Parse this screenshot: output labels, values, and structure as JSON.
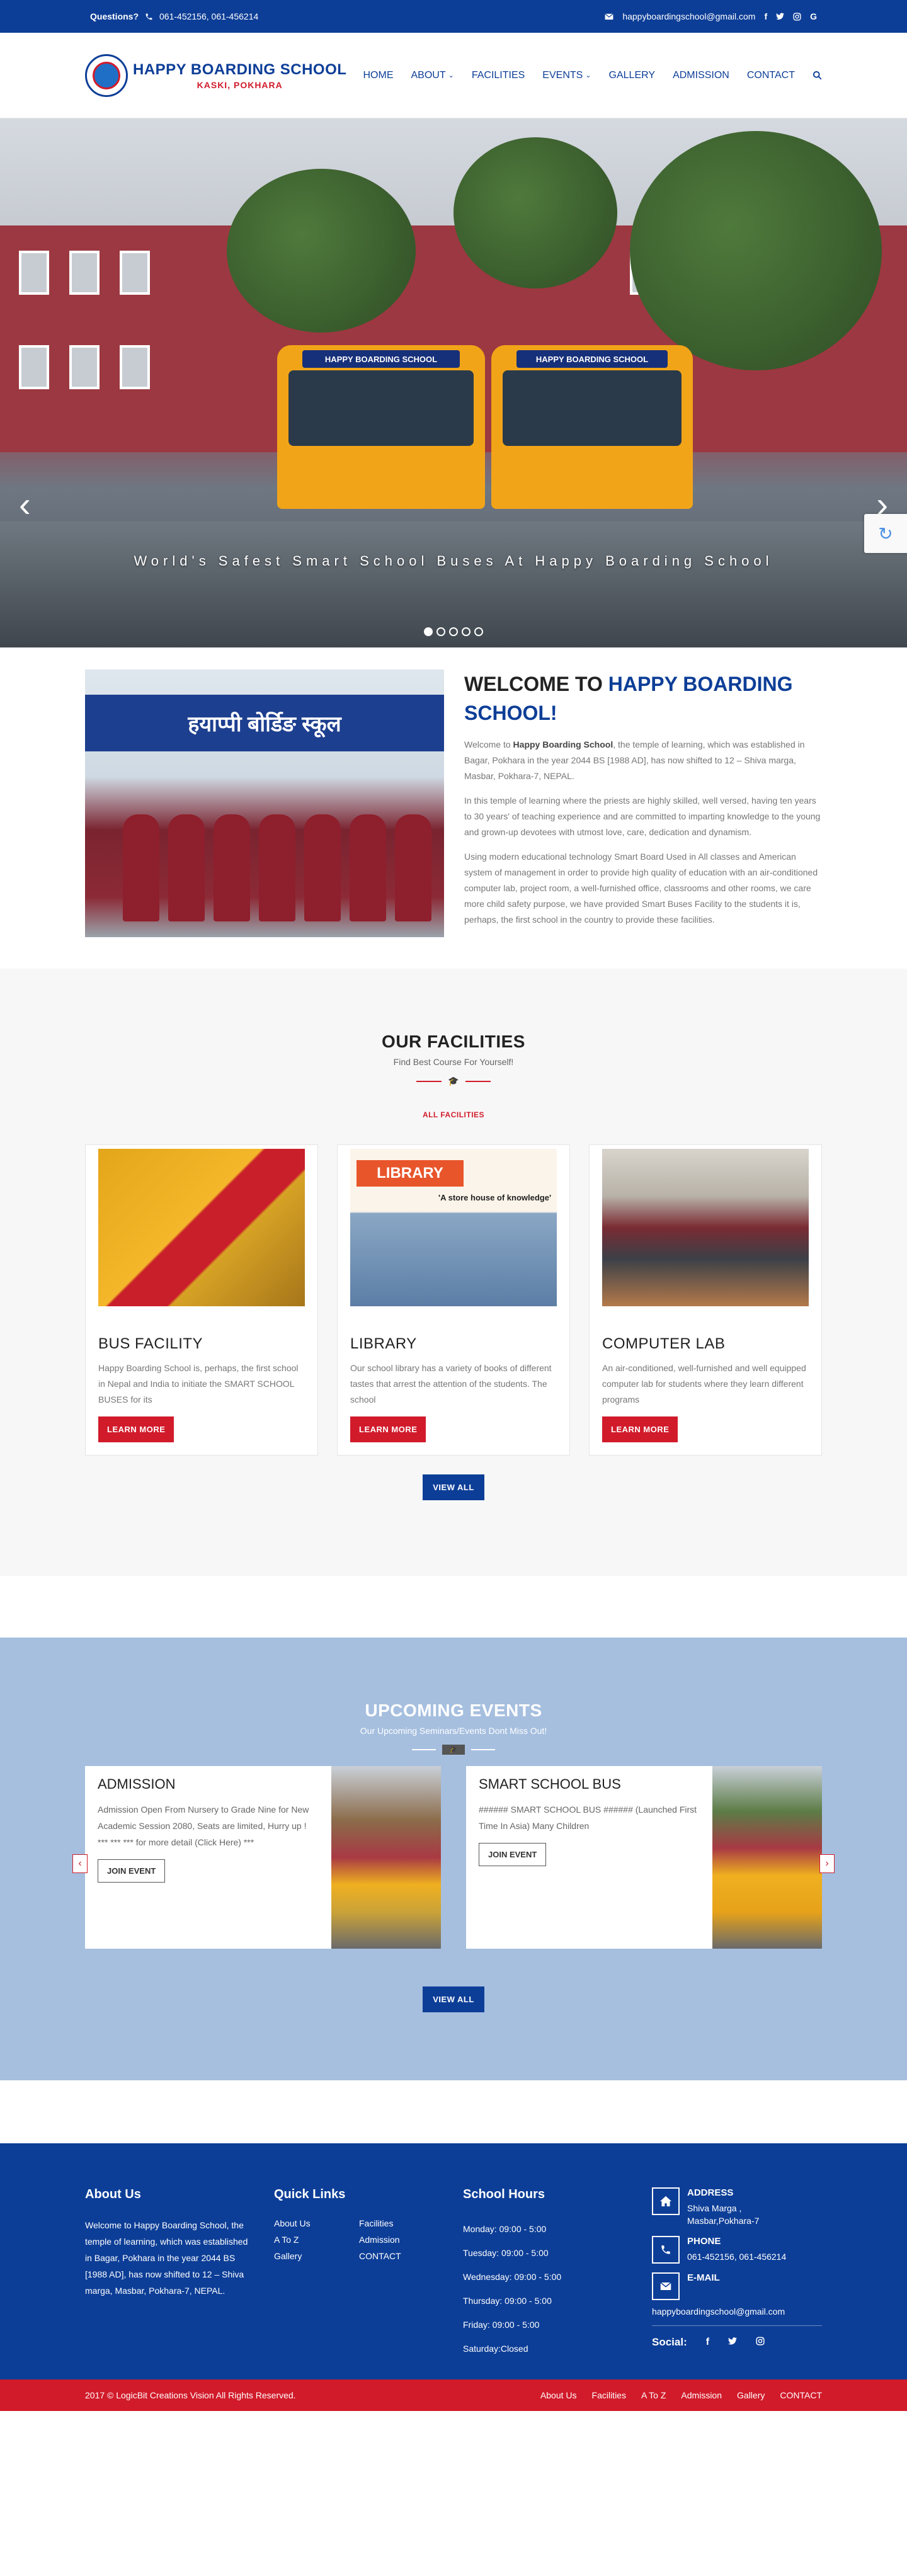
{
  "topbar": {
    "questions_label": "Questions?",
    "phone": "061-452156, 061-456214",
    "email": "happyboardingschool@gmail.com",
    "colors": {
      "background": "#0d3e97",
      "text": "#ffffff"
    }
  },
  "header": {
    "school_name": "HAPPY BOARDING SCHOOL",
    "school_location": "KASKI, POKHARA",
    "nav": [
      {
        "label": "HOME"
      },
      {
        "label": "ABOUT"
      },
      {
        "label": "FACILITIES"
      },
      {
        "label": "EVENTS"
      },
      {
        "label": "GALLERY"
      },
      {
        "label": "ADMISSION"
      },
      {
        "label": "CONTACT"
      }
    ]
  },
  "hero": {
    "bus_sign_1": "HAPPY BOARDING SCHOOL",
    "bus_sign_2": "HAPPY BOARDING SCHOOL",
    "caption": "World's Safest Smart School Buses At Happy Boarding School",
    "slide_count": 5,
    "active_slide": 1
  },
  "welcome": {
    "title_prefix": "WELCOME TO ",
    "title_highlight": "HAPPY BOARDING SCHOOL!",
    "banner_text": "हयाप्पी बोर्डिङ स्कूल",
    "p1_prefix": "Welcome to ",
    "p1_bold": "Happy Boarding School",
    "p1_rest": ", the temple of learning, which was established in Bagar, Pokhara in the year 2044 BS [1988 AD], has now shifted to 12 – Shiva marga, Masbar, Pokhara-7, NEPAL.",
    "p2": "In this temple of learning where the priests are highly skilled, well versed, having ten years to 30 years' of teaching experience and are committed to imparting knowledge to the young and grown-up devotees with utmost love, care, dedication and dynamism.",
    "p3": "Using modern educational technology Smart Board Used in All classes and American system of management in order to provide high quality of education with an air-conditioned computer lab, project room, a well-furnished office, classrooms and other rooms, we care more child safety purpose, we have provided Smart Buses Facility to the students it is, perhaps, the first school in the country to provide these facilities."
  },
  "facilities": {
    "title": "OUR FACILITIES",
    "subtitle": "Find Best Course For Yourself!",
    "all_link": "ALL FACILITIES",
    "cards": [
      {
        "title": "BUS FACILITY",
        "text": "Happy Boarding School is, perhaps, the first school in Nepal and India to initiate the SMART SCHOOL BUSES for its",
        "button": "LEARN MORE"
      },
      {
        "title": "LIBRARY",
        "text": "Our school library has a variety of books of different tastes that arrest the attention of the students. The school",
        "button": "LEARN MORE",
        "img_label": "LIBRARY",
        "img_sub": "'A store house of knowledge'"
      },
      {
        "title": "COMPUTER LAB",
        "text": "An air-conditioned, well-furnished and well equipped computer lab for students where they learn different programs",
        "button": "LEARN MORE"
      }
    ],
    "view_all": "VIEW ALL"
  },
  "events": {
    "title": "UPCOMING EVENTS",
    "subtitle": "Our Upcoming Seminars/Events Dont Miss Out!",
    "items": [
      {
        "title": "ADMISSION",
        "text": "Admission Open From Nursery to Grade Nine for New Academic Session 2080, Seats are limited, Hurry up ! *** *** *** for more detail (Click Here) ***",
        "button": "JOIN EVENT"
      },
      {
        "title": "SMART SCHOOL BUS",
        "text": "###### SMART SCHOOL BUS ######   (Launched First Time In Asia) Many Children",
        "button": "JOIN EVENT"
      }
    ],
    "view_all": "VIEW ALL"
  },
  "footer": {
    "about_title": "About Us",
    "about_text": "Welcome to Happy Boarding School, the temple of learning, which was established in Bagar, Pokhara in the year 2044 BS [1988 AD], has now shifted to 12 – Shiva marga, Masbar, Pokhara-7, NEPAL.",
    "links_title": "Quick Links",
    "links": [
      "About Us",
      "Facilities",
      "A To Z",
      "Admission",
      "Gallery",
      "CONTACT"
    ],
    "hours_title": "School Hours",
    "hours": [
      "Monday: 09:00 - 5:00",
      "Tuesday: 09:00 - 5:00",
      "Wednesday: 09:00 - 5:00",
      "Thursday: 09:00 - 5:00",
      "Friday: 09:00 - 5:00",
      "Saturday:Closed"
    ],
    "address_title": "ADDRESS",
    "address_line1": "Shiva Marga ,",
    "address_line2": "Masbar,Pokhara-7",
    "phone_title": "PHONE",
    "phone": "061-452156, 061-456214",
    "email_title": "E-MAIL",
    "email": "happyboardingschool@gmail.com",
    "social_label": "Social:"
  },
  "bottombar": {
    "copyright": "2017 © LogicBit Creations Vision All Rights Reserved.",
    "links": [
      "About Us",
      "Facilities",
      "A To Z",
      "Admission",
      "Gallery",
      "CONTACT"
    ]
  },
  "icons": [
    "phone-icon",
    "envelope-icon",
    "facebook-icon",
    "twitter-icon",
    "instagram-icon",
    "google-icon",
    "search-icon",
    "graduation-cap-icon",
    "home-icon",
    "chevron-left-icon",
    "chevron-right-icon"
  ]
}
